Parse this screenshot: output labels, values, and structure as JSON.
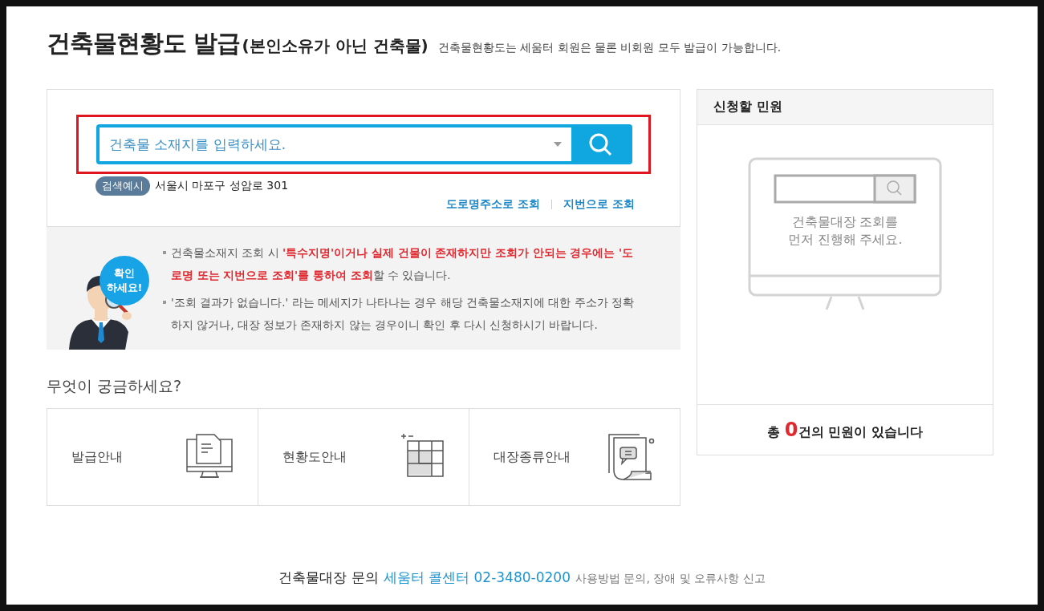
{
  "header": {
    "title": "건축물현황도 발급",
    "title_note": "(본인소유가 아닌 건축물)",
    "subtitle": "건축물현황도는 세움터 회원은 물론 비회원 모두 발급이 가능합니다."
  },
  "search": {
    "placeholder": "건축물 소재지를 입력하세요.",
    "example_badge": "검색예시",
    "example_text": "서울시 마포구 성암로 301",
    "links": [
      "도로명주소로 조회",
      "지번으로 조회"
    ]
  },
  "notice": {
    "badge_lines": [
      "확인",
      "하세요!"
    ],
    "items": [
      "건축물소재지 조회 시 **'특수지명'이거나 실제 건물이 존재하지만 조회가 안되는 경우에는 '도로명 또는 지번으로 조회'를 통하여 조회**할 수 있습니다.",
      "'조회 결과가 없습니다.' 라는 메세지가 나타나는 경우 해당 건축물소재지에 대한 주소가 정확하지 않거나, 대장 정보가 존재하지 않는 경우이니 확인 후 다시 신청하시기 바랍니다."
    ]
  },
  "faq": {
    "title": "무엇이 궁금하세요?",
    "cards": [
      {
        "label": "발급안내"
      },
      {
        "label": "현황도안내"
      },
      {
        "label": "대장종류안내"
      }
    ]
  },
  "side_panel": {
    "title": "신청할 민원",
    "empty_lines": [
      "건축물대장 조회를",
      "먼저 진행해 주세요."
    ],
    "summary": "총 **0**건의 민원이 있습니다"
  },
  "footer": {
    "label": "건축물대장 문의",
    "contact": "세움터 콜센터 02-3480-0200",
    "note": "사용방법 문의, 장애 및 오류사항 신고"
  }
}
